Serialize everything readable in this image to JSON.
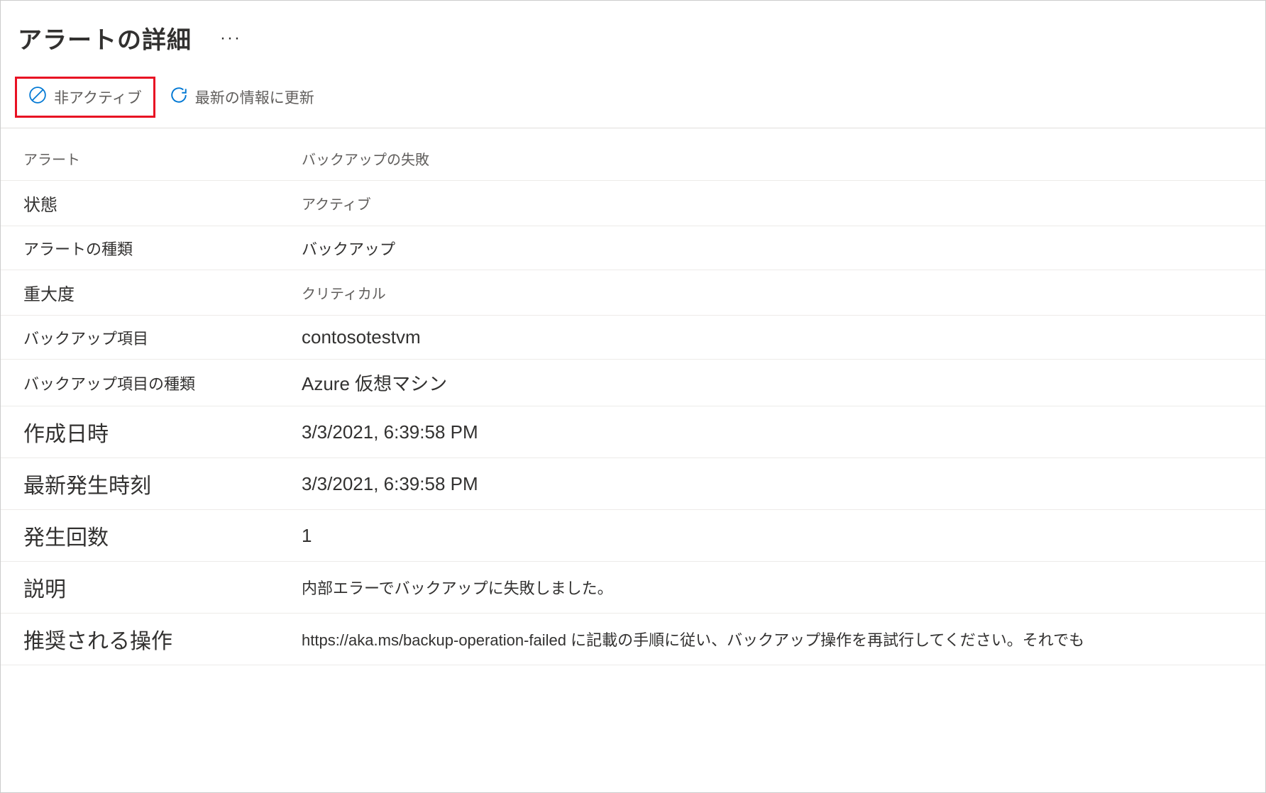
{
  "header": {
    "title": "アラートの詳細"
  },
  "toolbar": {
    "inactive_label": "非アクティブ",
    "refresh_label": "最新の情報に更新"
  },
  "details": {
    "alert": {
      "label": "アラート",
      "value": "バックアップの失敗"
    },
    "state": {
      "label": "状態",
      "value": "アクティブ"
    },
    "alert_type": {
      "label": "アラートの種類",
      "value": "バックアップ"
    },
    "severity": {
      "label": "重大度",
      "value": "クリティカル"
    },
    "backup_item": {
      "label": "バックアップ項目",
      "value": "contosotestvm"
    },
    "backup_item_type": {
      "label": "バックアップ項目の種類",
      "value": "Azure 仮想マシン"
    },
    "created": {
      "label": "作成日時",
      "value": "3/3/2021, 6:39:58 PM"
    },
    "last_occurred": {
      "label": "最新発生時刻",
      "value": "3/3/2021, 6:39:58 PM"
    },
    "occurrence_count": {
      "label": "発生回数",
      "value": "1"
    },
    "description": {
      "label": "説明",
      "value": "内部エラーでバックアップに失敗しました。"
    },
    "recommended_action": {
      "label": "推奨される操作",
      "value": "https://aka.ms/backup-operation-failed に記載の手順に従い、バックアップ操作を再試行してください。それでも"
    }
  },
  "colors": {
    "accent": "#0078d4",
    "highlight_border": "#e81123"
  }
}
